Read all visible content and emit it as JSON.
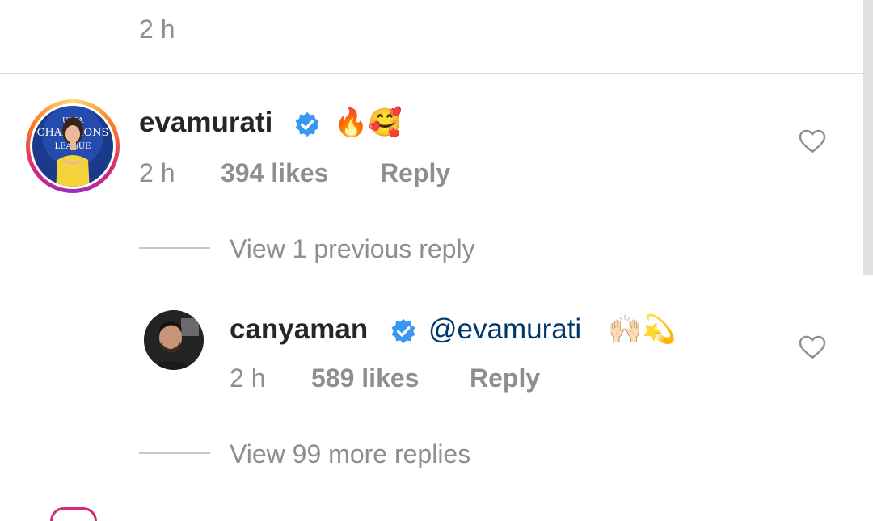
{
  "prev_comment": {
    "time": "2 h"
  },
  "comment": {
    "username": "evamurati",
    "avatar_lettering": [
      "UEFA",
      "CHAMPIONS",
      "LEAGUE"
    ],
    "emoji": "🔥🥰",
    "time": "2 h",
    "likes": "394 likes",
    "reply_label": "Reply",
    "view_previous": "View 1 previous reply"
  },
  "reply": {
    "username": "canyaman",
    "mention": "@evamurati",
    "emoji": "🙌🏻💫",
    "time": "2 h",
    "likes": "589 likes",
    "reply_label": "Reply"
  },
  "view_more": "View 99 more replies",
  "icons": {
    "verified": "verified-badge-icon",
    "heart": "heart-outline-icon"
  },
  "colors": {
    "verified": "#3897f0",
    "mention": "#00376b",
    "muted": "#8e8e8e",
    "text": "#262626"
  }
}
